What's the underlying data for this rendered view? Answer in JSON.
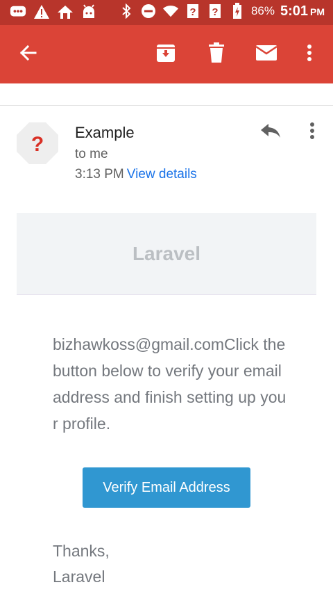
{
  "status_bar": {
    "battery": "86%",
    "time": "5:01",
    "ampm": "PM",
    "icons": [
      "message-icon",
      "warning-icon",
      "home-icon",
      "android-icon",
      "bluetooth-icon",
      "do-not-disturb-icon",
      "wifi-icon",
      "no-signal-icon",
      "no-signal-icon",
      "battery-charging-icon"
    ]
  },
  "app_bar": {
    "icons": [
      "back-arrow-icon",
      "archive-icon",
      "delete-icon",
      "mark-unread-icon",
      "more-vert-icon"
    ]
  },
  "email": {
    "sender": "Example",
    "recipient": "to me",
    "time": "3:13 PM",
    "view_details": "View details",
    "avatar_glyph": "?",
    "brand": "Laravel",
    "body": "bizhawkoss@gmail.comClick the button below to verify your email address and finish setting up your profile.",
    "button_label": "Verify Email Address",
    "signoff_line1": "Thanks,",
    "signoff_line2": "Laravel"
  },
  "colors": {
    "status_bar": "#b8352b",
    "app_bar": "#db4437",
    "link": "#1a73e8",
    "button": "#3097d1",
    "body_text": "#74787e"
  }
}
